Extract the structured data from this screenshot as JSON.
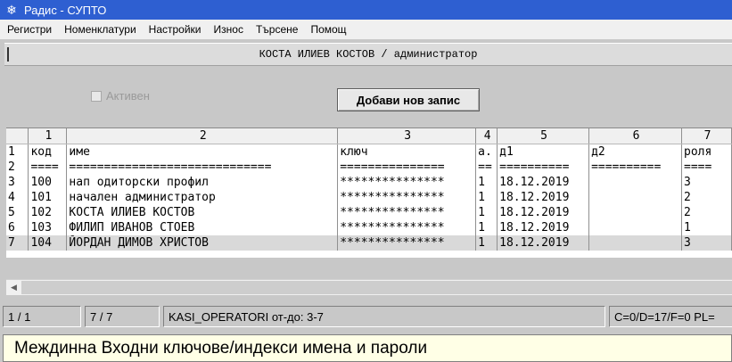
{
  "window": {
    "title": "Радис - СУПТО"
  },
  "menu": [
    "Регистри",
    "Номенклатури",
    "Настройки",
    "Износ",
    "Търсене",
    "Помощ"
  ],
  "header": {
    "user": "КОСТА ИЛИЕВ КОСТОВ / администратор"
  },
  "filter": {
    "active_label": "Активен",
    "active_checked": false
  },
  "toolbar": {
    "add_label": "Добави нов запис"
  },
  "grid": {
    "column_numbers": [
      "1",
      "2",
      "3",
      "4",
      "5",
      "6",
      "7"
    ],
    "header_row": {
      "rownum": "1",
      "cells": [
        "код",
        "име",
        "ключ",
        "а.",
        "д1",
        "д2",
        "роля"
      ]
    },
    "separator_row": {
      "rownum": "2",
      "cells": [
        "====",
        "=============================",
        "===============",
        "==",
        "==========",
        "==========",
        "===="
      ]
    },
    "rows": [
      {
        "rownum": "3",
        "cells": [
          "100",
          "нап одиторски профил",
          "***************",
          "1",
          "18.12.2019",
          "",
          "3"
        ]
      },
      {
        "rownum": "4",
        "cells": [
          "101",
          "начален администратор",
          "***************",
          "1",
          "18.12.2019",
          "",
          "2"
        ]
      },
      {
        "rownum": "5",
        "cells": [
          "102",
          "КОСТА ИЛИЕВ КОСТОВ",
          "***************",
          "1",
          "18.12.2019",
          "",
          "2"
        ]
      },
      {
        "rownum": "6",
        "cells": [
          "103",
          "ФИЛИП ИВАНОВ СТОЕВ",
          "***************",
          "1",
          "18.12.2019",
          "",
          "1"
        ]
      },
      {
        "rownum": "7",
        "cells": [
          "104",
          "ЙОРДАН ДИМОВ ХРИСТОВ",
          "***************",
          "1",
          "18.12.2019",
          "",
          "3"
        ]
      }
    ]
  },
  "status": {
    "position": "1 / 1",
    "rows": "7 / 7",
    "table": "KASI_OPERATORI от-до: 3-7",
    "counters": "C=0/D=17/F=0 PL="
  },
  "message": "Междинна Входни ключове/индекси имена и пароли",
  "colors": {
    "titlebar": "#2e5fd1",
    "message_bg": "#ffffe6",
    "selected_row": "#d9d9d9"
  }
}
